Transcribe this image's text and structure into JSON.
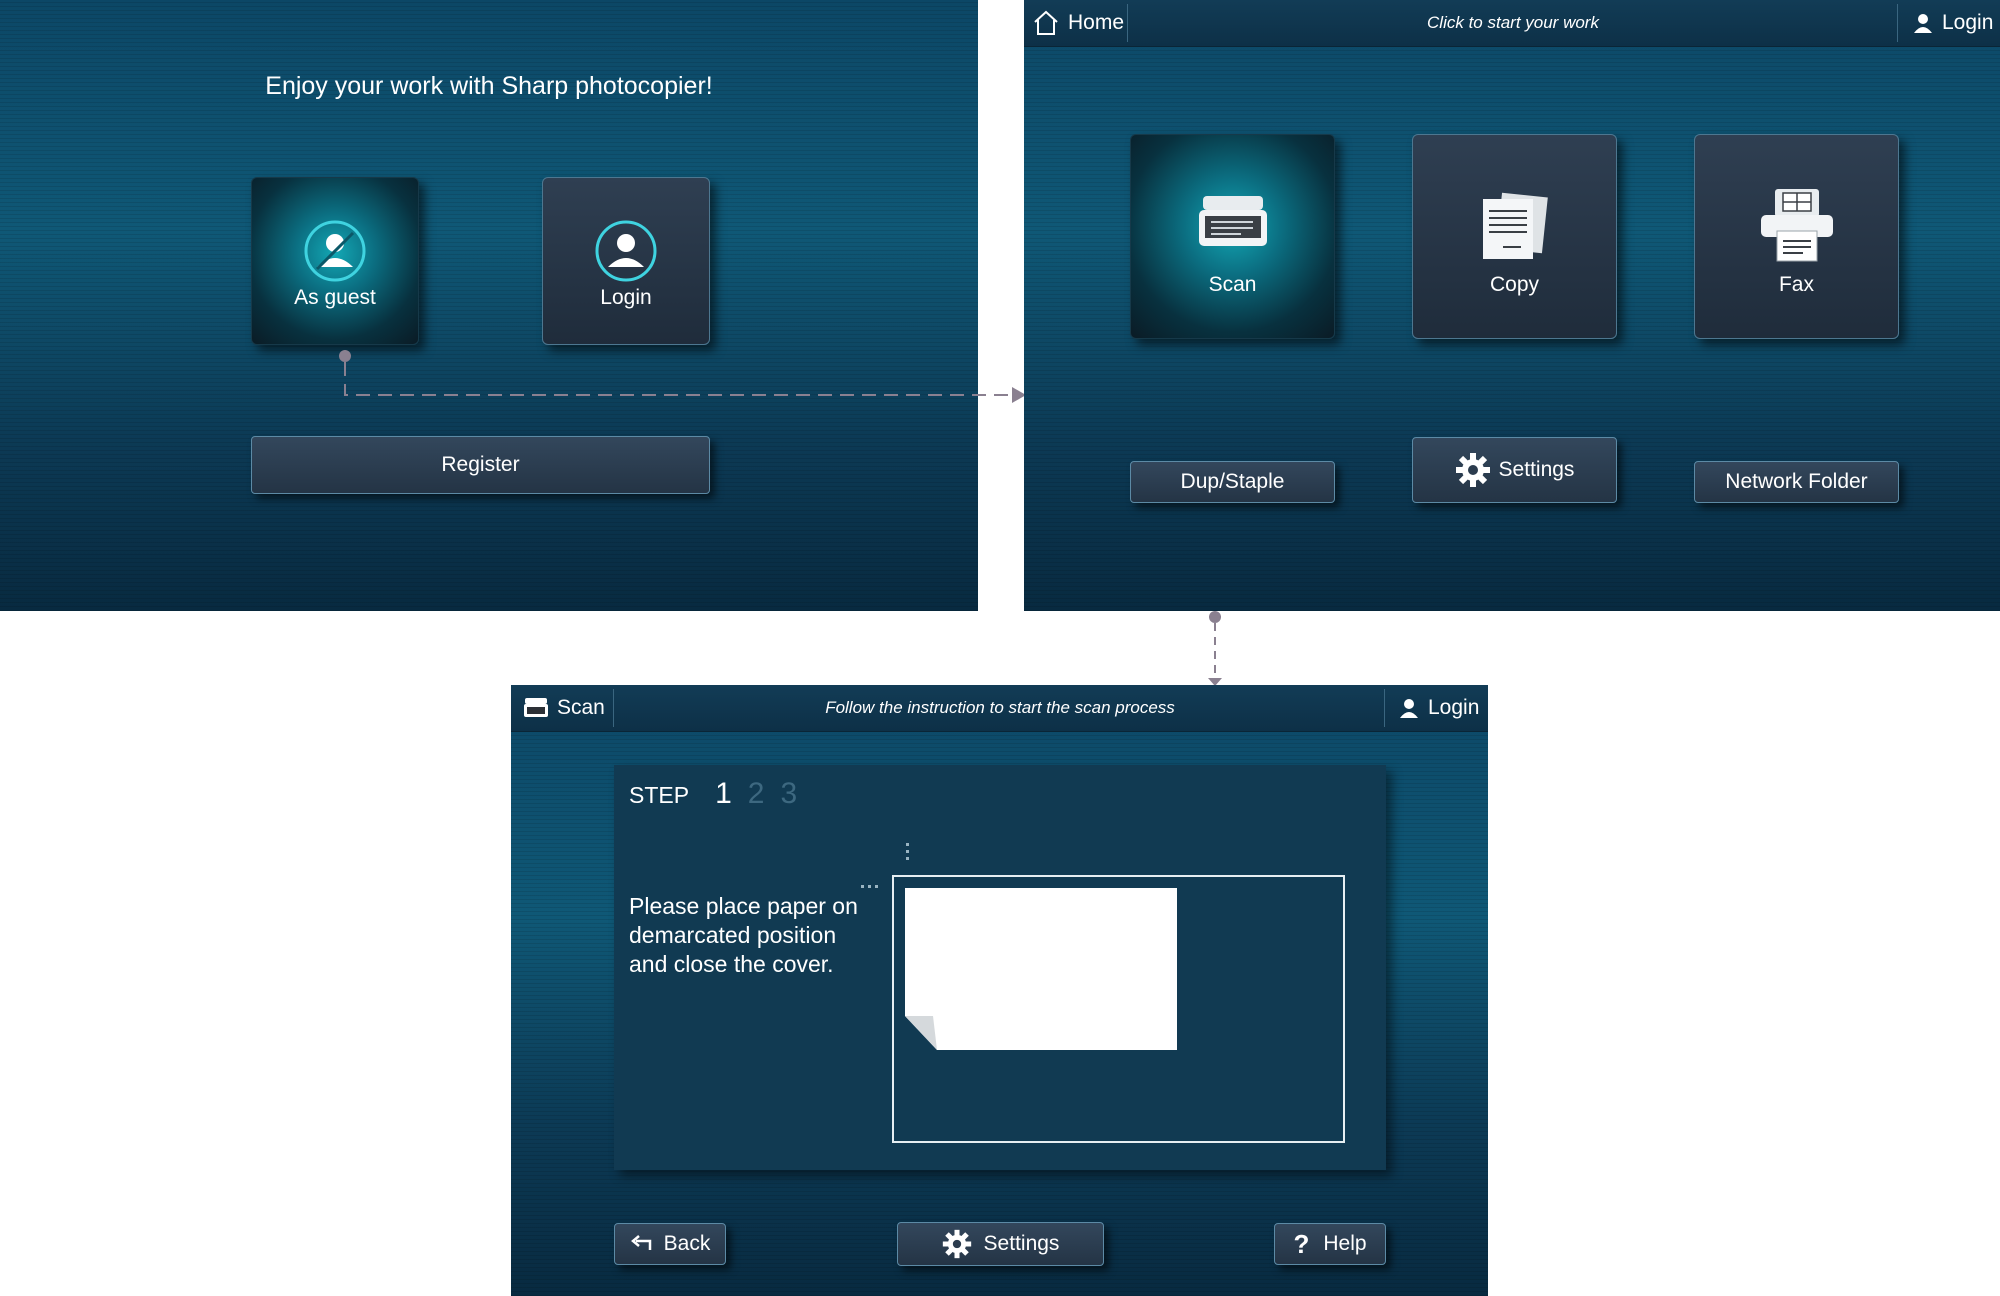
{
  "screen1": {
    "title": "Enjoy your work with Sharp photocopier!",
    "guest_label": "As guest",
    "login_label": "Login",
    "register_label": "Register"
  },
  "screen2": {
    "home_label": "Home",
    "header_message": "Click to start your work",
    "login_label": "Login",
    "tiles": [
      {
        "label": "Scan",
        "icon": "scanner-icon"
      },
      {
        "label": "Copy",
        "icon": "documents-icon"
      },
      {
        "label": "Fax",
        "icon": "fax-icon"
      }
    ],
    "buttons": {
      "dup_staple": "Dup/Staple",
      "settings": "Settings",
      "network_folder": "Network Folder"
    }
  },
  "screen3": {
    "title": "Scan",
    "header_message": "Follow the instruction to start the scan process",
    "login_label": "Login",
    "step_label": "STEP",
    "steps": [
      "1",
      "2",
      "3"
    ],
    "current_step": "1",
    "instruction": "Please place paper on demarcated position and close the cover.",
    "footer": {
      "back": "Back",
      "settings": "Settings",
      "help": "Help"
    }
  },
  "colors": {
    "background_top": "#0f5876",
    "background_bottom": "#082a40",
    "accent": "#13a7b4",
    "step_inactive": "#3d6880"
  }
}
